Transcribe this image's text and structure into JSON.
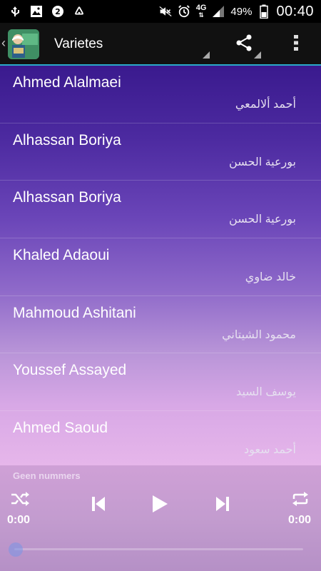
{
  "status_bar": {
    "battery_percent": "49%",
    "time": "00:40",
    "network": "4G",
    "icons": [
      "usb-icon",
      "image-icon",
      "opera-icon",
      "recycle-icon",
      "mute-icon",
      "alarm-icon",
      "signal-icon",
      "battery-icon"
    ]
  },
  "action_bar": {
    "title": "Varietes",
    "share_icon": "share-icon",
    "menu_icon": "overflow-menu-icon"
  },
  "reciters": [
    {
      "name": "Ahmed Alalmaei",
      "arabic": "أحمد ألالمعي"
    },
    {
      "name": "Alhassan Boriya",
      "arabic": "بورعية الحسن"
    },
    {
      "name": "Alhassan Boriya",
      "arabic": "بورعية الحسن"
    },
    {
      "name": "Khaled Adaoui",
      "arabic": "خالد ضاوي"
    },
    {
      "name": "Mahmoud Ashitani",
      "arabic": "محمود الشيتاني"
    },
    {
      "name": "Youssef Assayed",
      "arabic": "يوسف السيد"
    },
    {
      "name": "Ahmed Saoud",
      "arabic": "أحمد سعود"
    }
  ],
  "player": {
    "now_playing": "Geen nummers",
    "elapsed": "0:00",
    "duration": "0:00",
    "progress": 0,
    "accent": "#2aa9c9"
  }
}
